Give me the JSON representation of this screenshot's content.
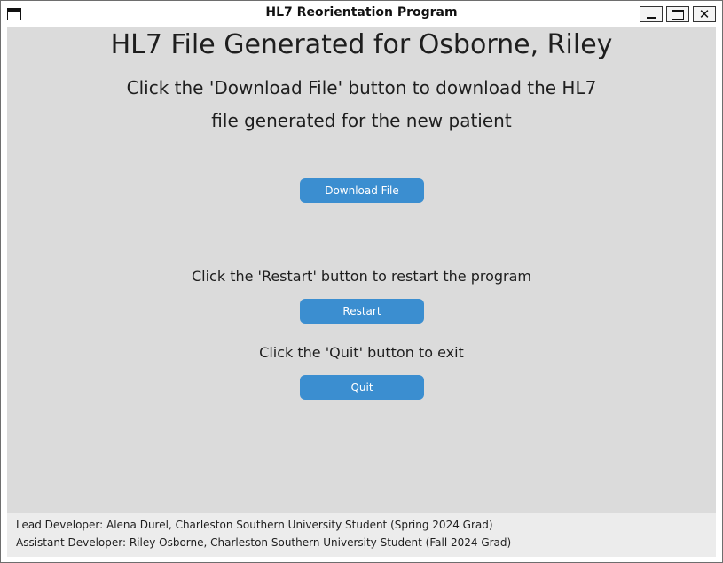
{
  "window": {
    "title": "HL7 Reorientation Program",
    "minimize_glyph": "_",
    "maximize_glyph": "□",
    "close_glyph": "✕"
  },
  "main": {
    "headline": "HL7 File Generated for Osborne, Riley",
    "download_instruction_line1": "Click the 'Download File' button to download the HL7",
    "download_instruction_line2": "file generated for the new patient",
    "download_button": "Download File",
    "restart_instruction": "Click the 'Restart' button to restart the program",
    "restart_button": "Restart",
    "quit_instruction": "Click the 'Quit' button to exit",
    "quit_button": "Quit"
  },
  "footer": {
    "lead_developer": "Lead Developer: Alena Durel, Charleston Southern University Student (Spring 2024 Grad)",
    "assistant_developer": "Assistant Developer: Riley Osborne, Charleston Southern University Student (Fall 2024 Grad)"
  },
  "colors": {
    "client_background": "#dbdbdb",
    "button": "#3b8ed0",
    "footer_background": "#ececec"
  }
}
